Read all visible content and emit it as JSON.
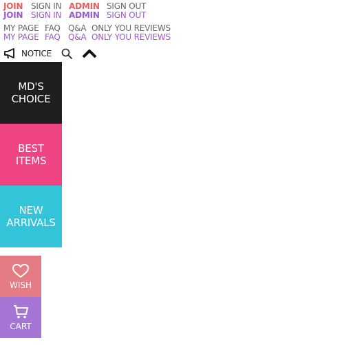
{
  "top_menu": {
    "join": "JOIN",
    "sign_in": "SIGN IN",
    "admin": "ADMIN",
    "sign_out": "SIGN OUT"
  },
  "secondary_menu": {
    "my_page": "MY PAGE",
    "faq": "FAQ",
    "qa": "Q&A",
    "only_you_reviews": "ONLY YOU REVIEWS"
  },
  "notice_bar": {
    "notice_label": "NOTICE",
    "icons": [
      "megaphone-icon",
      "search-icon",
      "chevron-up-icon"
    ]
  },
  "category_panels": [
    {
      "line1": "MD'S",
      "line2": "CHOICE",
      "color": "#1f1f1f"
    },
    {
      "line1": "BEST",
      "line2": "ITEMS",
      "color": "#ee4483"
    },
    {
      "line1": "NEW",
      "line2": "ARRIVALS",
      "color": "#33c4d9"
    }
  ],
  "quick_links": {
    "wish": {
      "label": "WISH",
      "icon": "heart-icon",
      "color": "#e57b85"
    },
    "cart": {
      "label": "CART",
      "icon": "cart-icon",
      "color": "#a575d6"
    }
  },
  "colors": {
    "gray_text": "#666666",
    "accent_red": "#e0605f",
    "accent_purple": "#9b59c9"
  }
}
